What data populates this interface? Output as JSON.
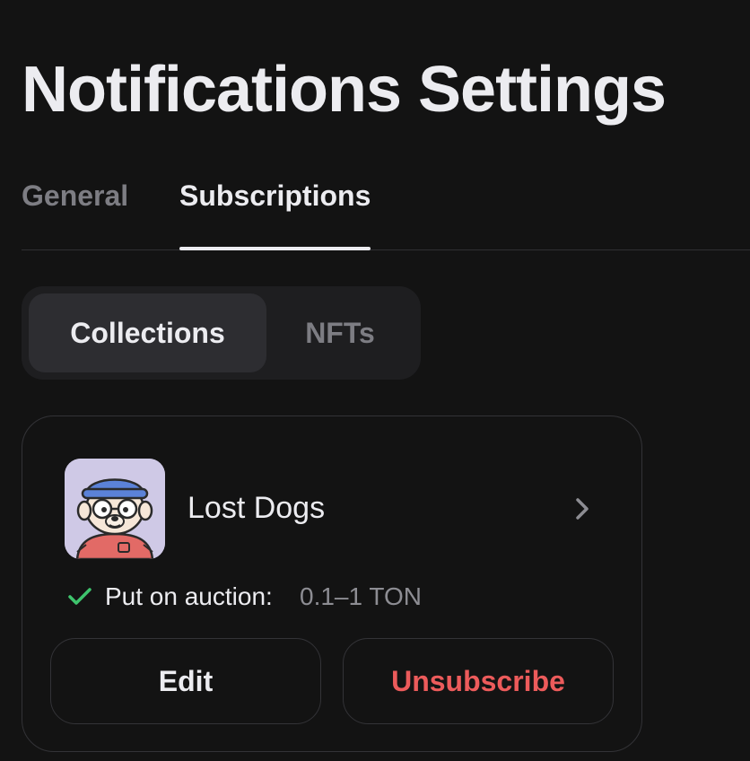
{
  "page": {
    "title": "Notifications Settings"
  },
  "tabs": [
    {
      "label": "General",
      "active": false
    },
    {
      "label": "Subscriptions",
      "active": true
    }
  ],
  "segmented": [
    {
      "label": "Collections",
      "active": true
    },
    {
      "label": "NFTs",
      "active": false
    }
  ],
  "subscription": {
    "collection_name": "Lost Dogs",
    "avatar_icon": "lost-dog-avatar",
    "rule": {
      "icon": "check-icon",
      "label": "Put on auction:",
      "value": "0.1–1 TON"
    },
    "edit_label": "Edit",
    "unsubscribe_label": "Unsubscribe"
  },
  "colors": {
    "background": "#131313",
    "text_primary": "#ececf0",
    "text_muted": "#7d7d83",
    "danger": "#ec5b5b",
    "success": "#3ec46d",
    "segment_bg": "#1e1e20",
    "segment_active": "#2d2d31"
  }
}
